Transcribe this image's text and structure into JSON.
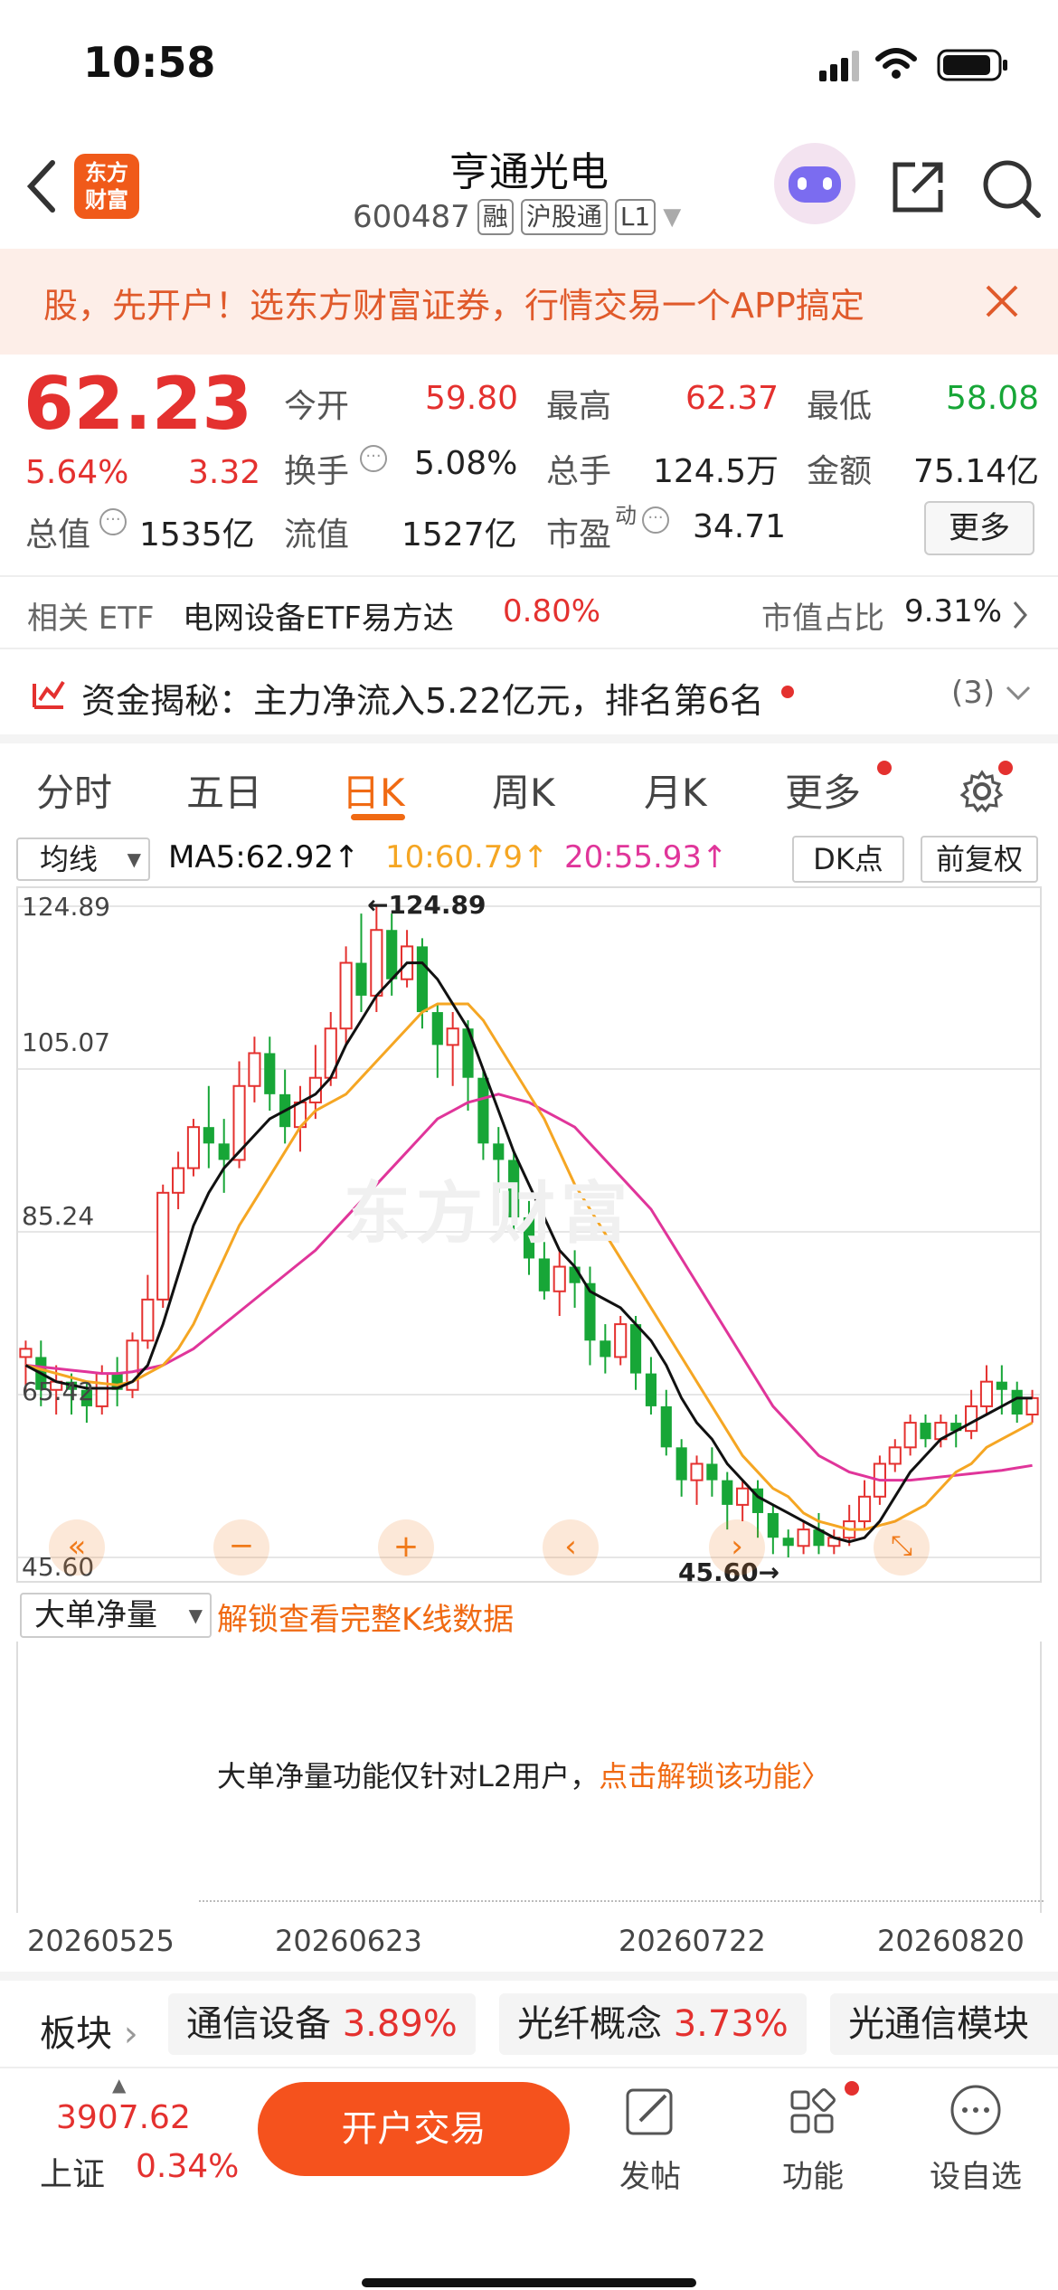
{
  "status_bar": {
    "time": "10:58"
  },
  "header": {
    "back_icon": "chevron-left-icon",
    "logo_text_1": "东方",
    "logo_text_2": "财富",
    "stock_name": "亨通光电",
    "stock_code": "600487",
    "tag_margin": "融",
    "tag_connect": "沪股通",
    "tag_level": "L1"
  },
  "banner": {
    "text": "股，先开户！选东方财富证券，行情交易一个APP搞定"
  },
  "quote": {
    "price": "62.23",
    "change_pct": "5.64%",
    "change_amt": "3.32",
    "open_label": "今开",
    "open": "59.80",
    "high_label": "最高",
    "high": "62.37",
    "low_label": "最低",
    "low": "58.08",
    "turnover_label": "换手",
    "turnover": "5.08%",
    "volume_label": "总手",
    "volume": "124.5万",
    "amount_label": "金额",
    "amount": "75.14亿",
    "mktcap_label": "总值",
    "mktcap": "1535亿",
    "float_label": "流值",
    "float": "1527亿",
    "pe_label": "市盈",
    "pe_sup": "动",
    "pe": "34.71",
    "more_button": "更多"
  },
  "etf_row": {
    "label": "相关 ETF",
    "etf_name": "电网设备ETF易方达",
    "etf_pct": "0.80%",
    "ratio_label": "市值占比",
    "ratio": "9.31%"
  },
  "fund_row": {
    "text": "资金揭秘：主力净流入5.22亿元，排名第6名",
    "count": "(3)"
  },
  "tabs": [
    "分时",
    "五日",
    "日K",
    "周K",
    "月K",
    "更多"
  ],
  "ma_row": {
    "selector": "均线",
    "ma5": "MA5:62.92",
    "ma10": "10:60.79",
    "ma20": "20:55.93",
    "dk_button": "DK点",
    "fq_button": "前复权"
  },
  "colors": {
    "ma5": "#111111",
    "ma10": "#f5a623",
    "ma20": "#e0359a",
    "up": "#e4312f",
    "down": "#17a637",
    "accent": "#f06a13"
  },
  "chart_data": {
    "type": "candlestick",
    "y_ticks": [
      "124.89",
      "105.07",
      "85.24",
      "65.42",
      "45.60"
    ],
    "ylim": [
      45.6,
      124.89
    ],
    "high_label": "124.89",
    "low_label": "45.60",
    "watermark": "东方财富",
    "candles": [
      [
        70,
        71,
        66,
        72
      ],
      [
        70,
        66,
        64,
        72
      ],
      [
        66,
        67,
        63,
        69
      ],
      [
        67,
        66,
        63,
        68
      ],
      [
        66,
        64,
        62,
        67
      ],
      [
        64,
        68,
        63,
        69
      ],
      [
        68,
        66,
        64,
        70
      ],
      [
        66,
        72,
        65,
        73
      ],
      [
        72,
        77,
        71,
        80
      ],
      [
        77,
        90,
        76,
        91
      ],
      [
        90,
        93,
        88,
        95
      ],
      [
        93,
        98,
        92,
        99
      ],
      [
        98,
        96,
        93,
        103
      ],
      [
        96,
        94,
        90,
        99
      ],
      [
        94,
        103,
        93,
        106
      ],
      [
        103,
        107,
        101,
        109
      ],
      [
        107,
        102,
        100,
        109
      ],
      [
        102,
        98,
        96,
        105
      ],
      [
        98,
        101,
        95,
        103
      ],
      [
        101,
        104,
        99,
        108
      ],
      [
        104,
        110,
        103,
        112
      ],
      [
        110,
        118,
        108,
        120
      ],
      [
        118,
        114,
        112,
        124
      ],
      [
        114,
        122,
        112,
        124.89
      ],
      [
        122,
        116,
        114,
        124
      ],
      [
        116,
        120,
        115,
        122
      ],
      [
        120,
        112,
        110,
        121
      ],
      [
        112,
        108,
        104,
        113
      ],
      [
        108,
        110,
        103,
        112
      ],
      [
        110,
        104,
        100,
        111
      ],
      [
        104,
        96,
        94,
        105
      ],
      [
        96,
        94,
        90,
        98
      ],
      [
        94,
        87,
        85,
        95
      ],
      [
        87,
        82,
        80,
        89
      ],
      [
        82,
        78,
        77,
        84
      ],
      [
        78,
        81,
        75,
        83
      ],
      [
        81,
        79,
        76,
        83
      ],
      [
        79,
        72,
        69,
        81
      ],
      [
        72,
        70,
        68,
        74
      ],
      [
        70,
        74,
        69,
        75
      ],
      [
        74,
        68,
        66,
        75
      ],
      [
        68,
        64,
        63,
        70
      ],
      [
        64,
        59,
        58,
        66
      ],
      [
        59,
        55,
        53,
        60
      ],
      [
        55,
        57,
        52,
        58
      ],
      [
        57,
        55,
        53,
        59
      ],
      [
        55,
        52,
        49,
        56
      ],
      [
        52,
        54,
        50,
        55
      ],
      [
        54,
        51,
        48,
        55
      ],
      [
        51,
        48,
        46,
        52
      ],
      [
        48,
        47,
        45.6,
        49
      ],
      [
        47,
        49,
        46,
        50
      ],
      [
        49,
        47,
        46,
        51
      ],
      [
        47,
        48,
        46,
        49
      ],
      [
        48,
        50,
        47,
        52
      ],
      [
        50,
        53,
        49,
        55
      ],
      [
        53,
        57,
        52,
        58
      ],
      [
        57,
        59,
        56,
        60
      ],
      [
        59,
        62,
        58,
        63
      ],
      [
        62,
        60,
        59,
        63
      ],
      [
        60,
        62,
        59,
        63
      ],
      [
        62,
        61,
        59,
        63
      ],
      [
        61,
        64,
        60,
        66
      ],
      [
        64,
        67,
        63,
        69
      ],
      [
        67,
        66,
        63,
        69
      ],
      [
        66,
        63,
        62,
        67
      ],
      [
        63,
        65,
        62,
        66
      ]
    ],
    "ma5": [
      69,
      68,
      67,
      66.6,
      66.2,
      66.2,
      66.2,
      67,
      69,
      74,
      80,
      86,
      90,
      93,
      95,
      97,
      99,
      100,
      101,
      102,
      104,
      108,
      111,
      114,
      116,
      118,
      118,
      116,
      113,
      110,
      105,
      100,
      95,
      91,
      87,
      83,
      81,
      78,
      77,
      76,
      74,
      72,
      69,
      65,
      62,
      60,
      57,
      55,
      53,
      52,
      51,
      50,
      49,
      48,
      47.5,
      48,
      50,
      53,
      56,
      58,
      60,
      61,
      62,
      63,
      64,
      65,
      65
    ],
    "ma10": [
      69,
      68.5,
      68,
      67.5,
      67,
      66.8,
      66.6,
      67,
      68,
      69,
      71,
      74,
      78,
      82,
      86,
      89,
      92,
      95,
      98,
      100,
      101,
      102,
      104,
      106,
      108,
      110,
      112,
      113,
      113,
      113,
      111,
      108,
      105,
      102,
      99,
      95,
      91,
      88,
      85,
      82,
      79,
      76,
      73,
      70,
      67,
      64,
      61,
      58,
      56,
      54,
      53,
      51,
      50,
      49.5,
      49,
      49,
      49.5,
      50,
      51,
      52,
      54,
      56,
      57,
      59,
      60,
      61,
      62
    ],
    "ma20": [
      69,
      68.8,
      68.6,
      68.4,
      68.2,
      68,
      68,
      68.2,
      68.6,
      69,
      70,
      71,
      72.5,
      74,
      75.5,
      77,
      78.5,
      80,
      81.5,
      83,
      85,
      87,
      89,
      91,
      93,
      95,
      97,
      99,
      100,
      101,
      101.5,
      102,
      101.5,
      101,
      100,
      99,
      98,
      96,
      94,
      92,
      90,
      88,
      85,
      82,
      79,
      76,
      73,
      70,
      67,
      64,
      62,
      60,
      58,
      57,
      56,
      55.5,
      55,
      55,
      55,
      55.2,
      55.4,
      55.6,
      55.8,
      56,
      56.2,
      56.5,
      56.8
    ]
  },
  "volume_row": {
    "selector": "大单净量",
    "unlock": "解锁查看完整K线数据"
  },
  "volume_panel": {
    "message": "大单净量功能仅针对L2用户，",
    "link": "点击解锁该功能",
    "link_arrow": "〉"
  },
  "dates": [
    "20260525",
    "20260623",
    "20260722",
    "20260820"
  ],
  "sector_row": {
    "label": "板块",
    "chips": [
      {
        "name": "通信设备",
        "pct": "3.89%"
      },
      {
        "name": "光纤概念",
        "pct": "3.73%"
      },
      {
        "name": "光通信模块",
        "pct": ""
      }
    ]
  },
  "bottom": {
    "index_value": "3907.62",
    "index_name": "上证",
    "index_pct": "0.34%",
    "trade_button": "开户交易",
    "post_label": "发帖",
    "func_label": "功能",
    "watch_label": "设自选"
  }
}
